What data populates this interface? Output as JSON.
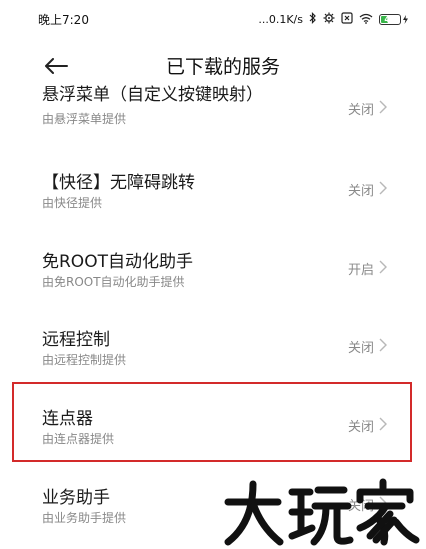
{
  "status_bar": {
    "time": "晚上7:20",
    "network_speed": "...0.1K/s",
    "icons": [
      "bluetooth-icon",
      "settings-icon",
      "signal-x-icon",
      "wifi-icon"
    ],
    "battery_level": "44",
    "battery_color": "#39b54a"
  },
  "header": {
    "title": "已下载的服务"
  },
  "services": [
    {
      "name": "悬浮菜单（自定义按键映射）",
      "provider": "由悬浮菜单提供",
      "status": "关闭"
    },
    {
      "name": "【快径】无障碍跳转",
      "provider": "由快径提供",
      "status": "关闭"
    },
    {
      "name": "免ROOT自动化助手",
      "provider": "由免ROOT自动化助手提供",
      "status": "开启"
    },
    {
      "name": "远程控制",
      "provider": "由远程控制提供",
      "status": "关闭"
    },
    {
      "name": "连点器",
      "provider": "由连点器提供",
      "status": "关闭"
    },
    {
      "name": "业务助手",
      "provider": "由业务助手提供",
      "status": "关闭"
    }
  ],
  "highlight_color": "#d32a2a",
  "watermark": "大玩家"
}
